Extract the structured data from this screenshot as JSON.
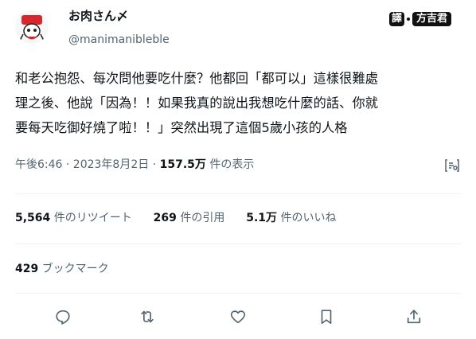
{
  "author": {
    "display_name": "お肉さん〆",
    "handle": "@manimanibleble"
  },
  "translation_badge": {
    "label": "譯",
    "translator": "方吉君"
  },
  "tweet": {
    "lines": [
      "和老公抱怨、每次問他要吃什麼？他都回「都可以」這樣很難處",
      "理之後、他說「因為！！如果我真的說出我想吃什麼的話、你就",
      "要每天吃御好燒了啦！！」突然出現了這個5歲小孩的人格"
    ]
  },
  "meta": {
    "time_date": "午後6:46 · 2023年8月2日 · ",
    "views_count": "157.5万",
    "views_label": " 件の表示"
  },
  "stats": {
    "retweets_count": "5,564",
    "retweets_label": " 件のリツイート",
    "quotes_count": "269",
    "quotes_label": " 件の引用",
    "likes_count": "5.1万",
    "likes_label": " 件のいいね"
  },
  "bookmarks": {
    "count": "429",
    "label": " ブックマーク"
  },
  "icons": [
    "analytics-icon",
    "reply-icon",
    "retweet-icon",
    "like-icon",
    "bookmark-icon",
    "share-icon"
  ],
  "colors": {
    "text": "#0f1419",
    "secondary": "#536471",
    "divider": "#eff3f4",
    "icon": "#536471"
  }
}
